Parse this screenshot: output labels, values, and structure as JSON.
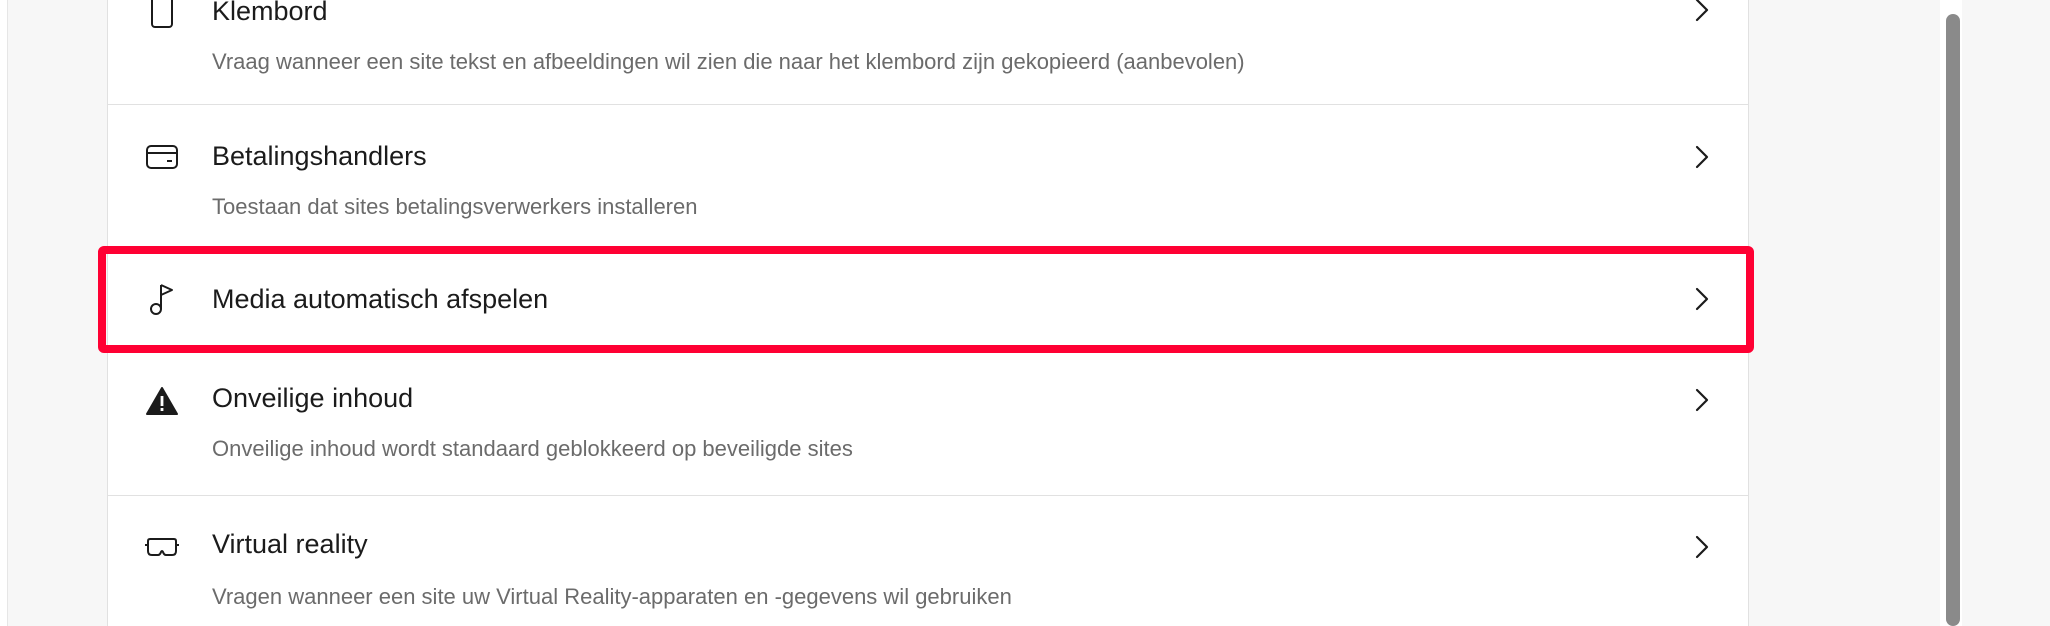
{
  "settings": {
    "items": [
      {
        "title": "Klembord",
        "description": "Vraag wanneer een site tekst en afbeeldingen wil zien die naar het klembord zijn gekopieerd (aanbevolen)",
        "icon": "clipboard-icon"
      },
      {
        "title": "Betalingshandlers",
        "description": "Toestaan dat sites betalingsverwerkers installeren",
        "icon": "credit-card-icon"
      },
      {
        "title": "Media automatisch afspelen",
        "icon": "music-note-icon"
      },
      {
        "title": "Onveilige inhoud",
        "description": "Onveilige inhoud wordt standaard geblokkeerd op beveiligde sites",
        "icon": "warning-icon"
      },
      {
        "title": "Virtual reality",
        "description": "Vragen wanneer een site uw Virtual Reality-apparaten en -gegevens wil gebruiken",
        "icon": "vr-headset-icon"
      }
    ]
  },
  "colors": {
    "highlight": "#ff0033",
    "title_text": "#1b1b1b",
    "description_text": "#6b6b6b",
    "divider": "#e1e1e1"
  }
}
